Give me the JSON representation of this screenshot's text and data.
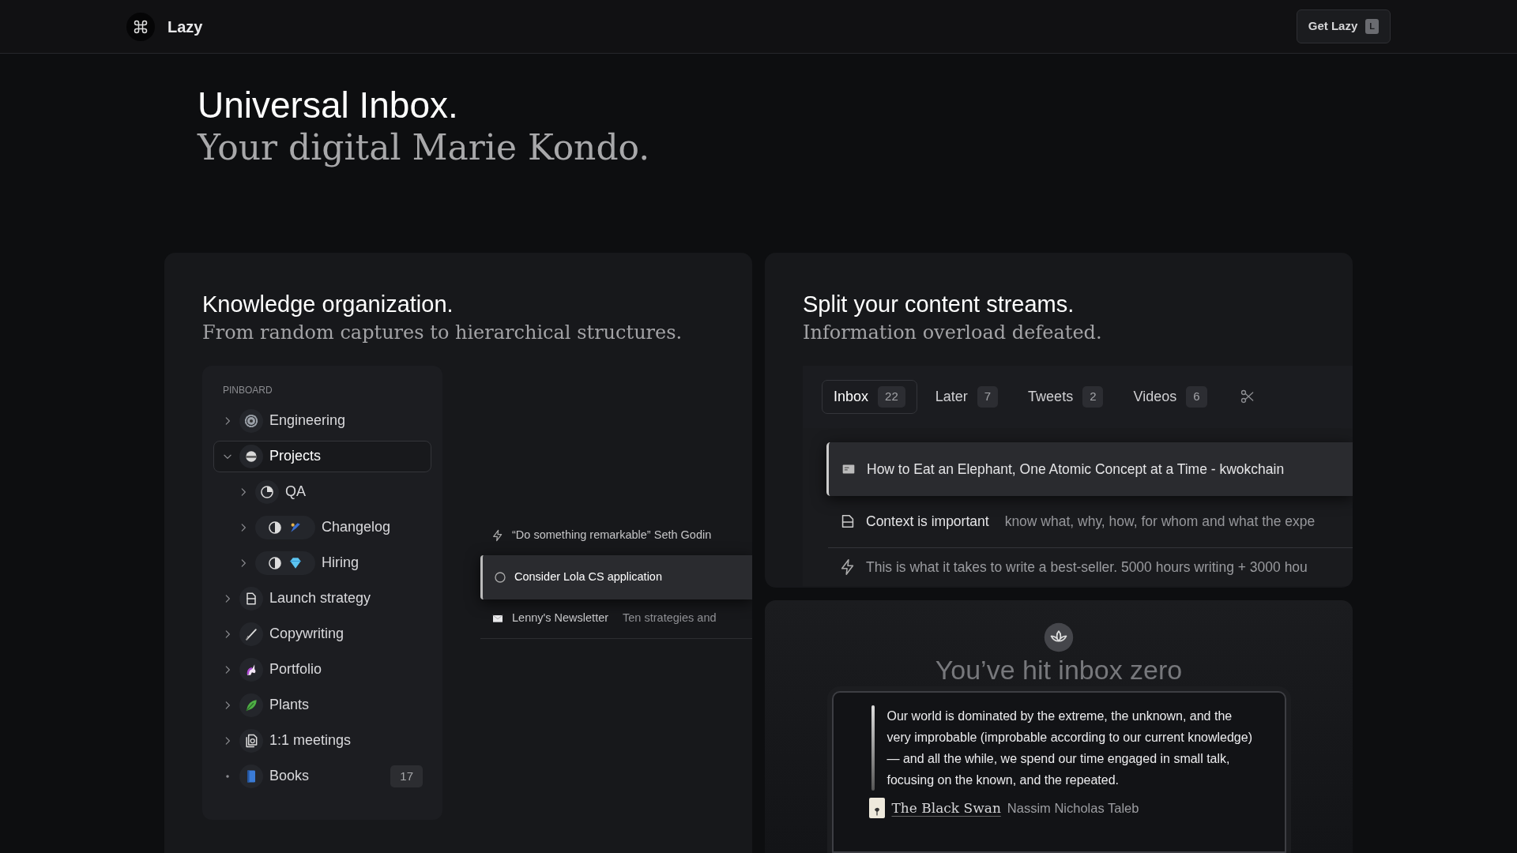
{
  "header": {
    "logo_text": "Lazy",
    "cta": {
      "label": "Get Lazy",
      "shortcut": "L"
    }
  },
  "hero": {
    "title": "Universal Inbox.",
    "subtitle": "Your digital Marie Kondo."
  },
  "knowledge_card": {
    "title": "Knowledge organization.",
    "subtitle": "From random captures to hierarchical structures.",
    "pinboard": {
      "heading": "PINBOARD",
      "items": [
        {
          "label": "Engineering",
          "kind": "folder",
          "expanded": false,
          "selected": false
        },
        {
          "label": "Projects",
          "kind": "folder",
          "expanded": true,
          "selected": true,
          "children": [
            {
              "label": "QA",
              "kind": "folder",
              "expanded": false,
              "selected": false
            },
            {
              "label": "Changelog",
              "kind": "folder",
              "expanded": false,
              "selected": false
            },
            {
              "label": "Hiring",
              "kind": "folder",
              "expanded": false,
              "selected": false
            }
          ]
        },
        {
          "label": "Launch strategy",
          "kind": "folder",
          "expanded": false,
          "selected": false
        },
        {
          "label": "Copywriting",
          "kind": "folder",
          "expanded": false,
          "selected": false
        },
        {
          "label": "Portfolio",
          "kind": "folder",
          "expanded": false,
          "selected": false
        },
        {
          "label": "Plants",
          "kind": "folder",
          "expanded": false,
          "selected": false
        },
        {
          "label": "1:1 meetings",
          "kind": "folder",
          "expanded": false,
          "selected": false
        },
        {
          "label": "Books",
          "kind": "leaf",
          "count": "17",
          "selected": false
        }
      ]
    },
    "captures": [
      {
        "kind": "quote",
        "text": "“Do something remarkable” Seth Godin",
        "selected": false
      },
      {
        "kind": "task",
        "text": "Consider Lola CS application",
        "selected": true
      },
      {
        "kind": "newsletter",
        "text": "Lenny's Newsletter",
        "preview": "Ten strategies and",
        "selected": false
      }
    ]
  },
  "streams_card": {
    "title": "Split your content streams.",
    "subtitle": "Information overload defeated.",
    "tabs": [
      {
        "label": "Inbox",
        "count": "22",
        "selected": true
      },
      {
        "label": "Later",
        "count": "7",
        "selected": false
      },
      {
        "label": "Tweets",
        "count": "2",
        "selected": false
      },
      {
        "label": "Videos",
        "count": "6",
        "selected": false
      }
    ],
    "items": [
      {
        "kind": "article",
        "title": "How to Eat an Elephant, One Atomic Concept at a Time - kwokchain",
        "selected": true
      },
      {
        "kind": "note",
        "title": "Context is important",
        "preview": "know what, why, how, for whom and what the expe",
        "selected": false
      },
      {
        "kind": "quote",
        "title": "This is what it takes to write a best-seller. 5000 hours writing + 3000 hou",
        "selected": false
      }
    ]
  },
  "inbox_zero": {
    "message": "You’ve hit inbox zero",
    "quote": {
      "text": "Our world is dominated by the extreme, the unknown, and the very improbable (improbable according to our current knowledge) — and all the while, we spend our time engaged in small talk, focusing on the known, and the repeated.",
      "book": "The Black Swan",
      "author": "Nassim Nicholas Taleb"
    }
  }
}
